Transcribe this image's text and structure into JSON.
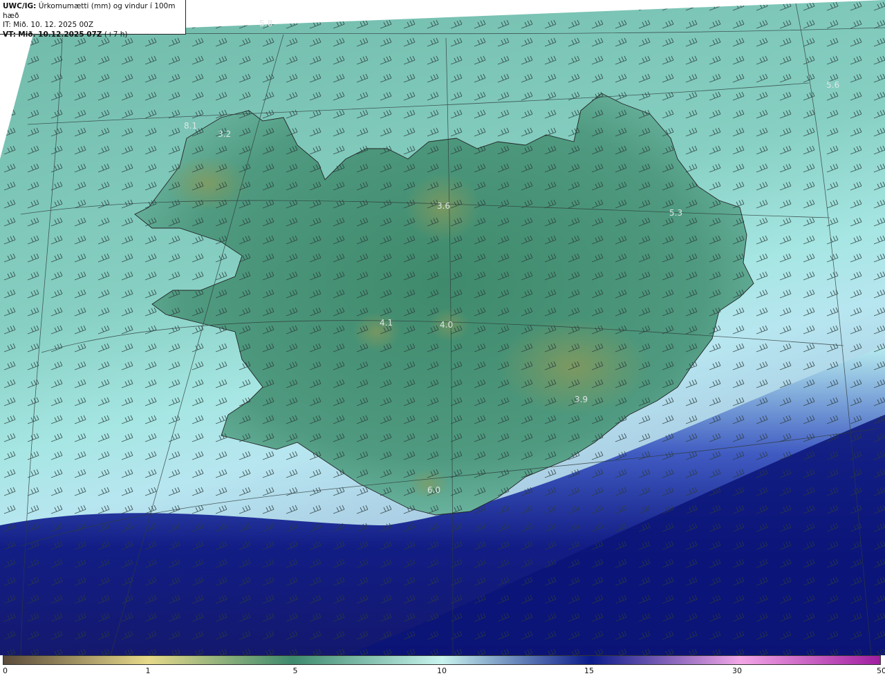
{
  "header": {
    "model": "UWC/IG:",
    "title": "Úrkomumætti (mm) og vindur í 100m hæð",
    "it_label": "IT:",
    "it_value": "Mið. 10. 12. 2025 00Z",
    "vt_label": "VT:",
    "vt_value": "Mið. 10.12.2025 07Z",
    "vt_offset": "(+7 h)"
  },
  "map_values": [
    {
      "id": "v1",
      "text": "5.8"
    },
    {
      "id": "v2",
      "text": "5.6"
    },
    {
      "id": "v3",
      "text": "8.1"
    },
    {
      "id": "v4",
      "text": "3.2"
    },
    {
      "id": "v5",
      "text": "3.6"
    },
    {
      "id": "v6",
      "text": "5.3"
    },
    {
      "id": "v7",
      "text": "4.1"
    },
    {
      "id": "v8",
      "text": "4.0"
    },
    {
      "id": "v9",
      "text": "3.9"
    },
    {
      "id": "v10",
      "text": "6.0"
    }
  ],
  "colorbar": {
    "ticks": [
      {
        "label": "0",
        "value": 0
      },
      {
        "label": "1",
        "value": 1
      },
      {
        "label": "5",
        "value": 5
      },
      {
        "label": "10",
        "value": 10
      },
      {
        "label": "15",
        "value": 15
      },
      {
        "label": "30",
        "value": 30
      },
      {
        "label": "50",
        "value": 50
      }
    ],
    "colors": [
      "#5a4a3a",
      "#e6d98a",
      "#3e8a6e",
      "#c9f4ee",
      "#0a1a8a",
      "#f2a6e6",
      "#a01ea0"
    ]
  }
}
